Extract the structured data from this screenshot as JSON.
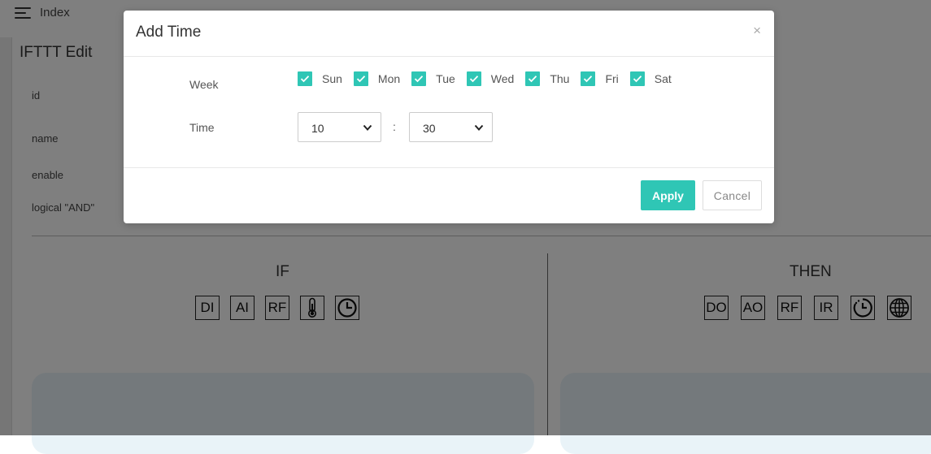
{
  "header": {
    "breadcrumb": "Index",
    "menu_icon": "hamburger-menu-icon"
  },
  "edit": {
    "title": "IFTTT Edit",
    "fields": [
      "id",
      "name",
      "enable",
      "logical \"AND\""
    ]
  },
  "if_section": {
    "title": "IF",
    "triggers": [
      "DI",
      "AI",
      "RF"
    ],
    "icons": [
      "thermometer-icon",
      "clock-icon"
    ]
  },
  "then_section": {
    "title": "THEN",
    "actions": [
      "DO",
      "AO",
      "RF",
      "IR"
    ],
    "icons": [
      "timer-icon",
      "globe-icon"
    ]
  },
  "modal": {
    "title": "Add Time",
    "close_label": "×",
    "week_label": "Week",
    "days": [
      {
        "label": "Sun",
        "checked": true
      },
      {
        "label": "Mon",
        "checked": true
      },
      {
        "label": "Tue",
        "checked": true
      },
      {
        "label": "Wed",
        "checked": true
      },
      {
        "label": "Thu",
        "checked": true
      },
      {
        "label": "Fri",
        "checked": true
      },
      {
        "label": "Sat",
        "checked": true
      }
    ],
    "time_label": "Time",
    "hour": "10",
    "separator": ":",
    "minute": "30",
    "apply_label": "Apply",
    "cancel_label": "Cancel"
  },
  "colors": {
    "accent": "#2fc6b5",
    "overlay": "rgba(0,0,0,0.5)"
  }
}
